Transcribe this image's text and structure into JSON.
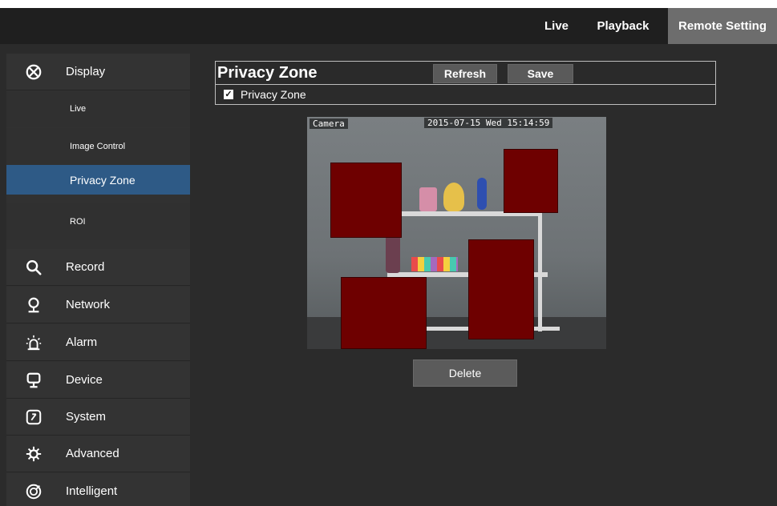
{
  "topnav": [
    {
      "label": "Live",
      "active": false
    },
    {
      "label": "Playback",
      "active": false
    },
    {
      "label": "Remote Setting",
      "active": true
    }
  ],
  "sidebar": {
    "items": [
      {
        "label": "Display",
        "icon": "display-icon",
        "type": "main"
      },
      {
        "label": "Live",
        "type": "sub"
      },
      {
        "label": "Image Control",
        "type": "sub"
      },
      {
        "label": "Privacy Zone",
        "type": "sub",
        "active": true
      },
      {
        "label": "ROI",
        "type": "sub"
      },
      {
        "label": "Record",
        "icon": "search-icon",
        "type": "main"
      },
      {
        "label": "Network",
        "icon": "network-icon",
        "type": "main"
      },
      {
        "label": "Alarm",
        "icon": "alarm-icon",
        "type": "main"
      },
      {
        "label": "Device",
        "icon": "device-icon",
        "type": "main"
      },
      {
        "label": "System",
        "icon": "system-icon",
        "type": "main"
      },
      {
        "label": "Advanced",
        "icon": "gear-icon",
        "type": "main"
      },
      {
        "label": "Intelligent",
        "icon": "intelligent-icon",
        "type": "main"
      }
    ]
  },
  "main": {
    "title": "Privacy Zone",
    "refresh_label": "Refresh",
    "save_label": "Save",
    "privacy_zone_checkbox": {
      "label": "Privacy Zone",
      "checked": true
    },
    "camera": {
      "name": "Camera",
      "timestamp": "2015-07-15 Wed 15:14:59"
    },
    "delete_label": "Delete"
  },
  "colors": {
    "accent_active": "#2e5a86",
    "mask": "#6e0000",
    "topbar_bg": "#1f1f1f",
    "active_tab_bg": "#6d6d6d"
  }
}
